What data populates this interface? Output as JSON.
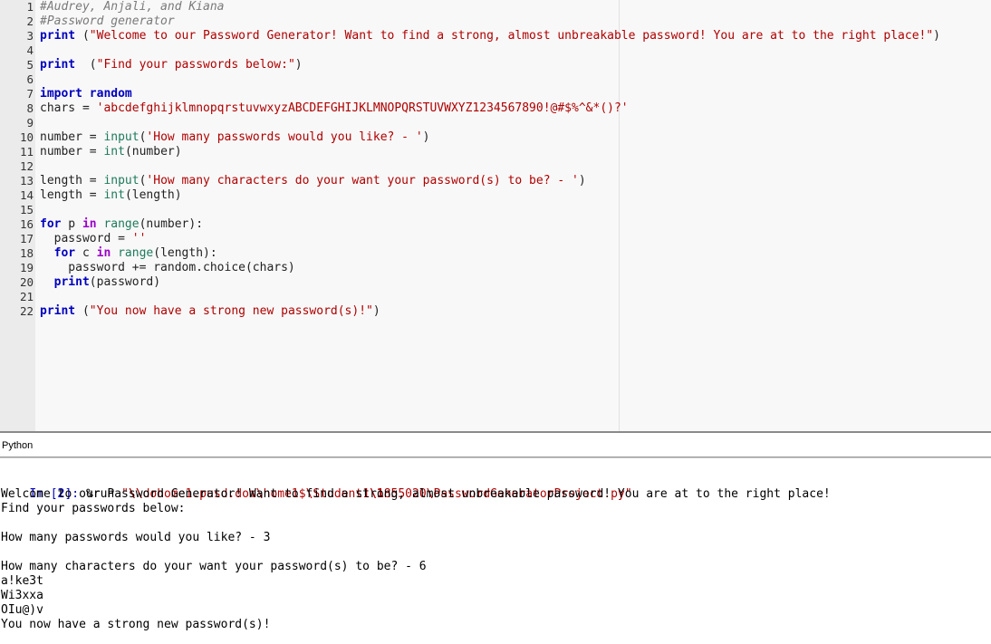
{
  "editor": {
    "lines": [
      {
        "num": "1",
        "tokens": [
          {
            "t": "#Audrey, Anjali, and Kiana",
            "c": "cm"
          }
        ]
      },
      {
        "num": "2",
        "tokens": [
          {
            "t": "#Password generator",
            "c": "cm"
          }
        ]
      },
      {
        "num": "3",
        "tokens": [
          {
            "t": "print",
            "c": "kw"
          },
          {
            "t": " (",
            "c": "pl"
          },
          {
            "t": "\"Welcome to our Password Generator! Want to find a strong, almost unbreakable password! You are at to the right place!\"",
            "c": "st"
          },
          {
            "t": ")",
            "c": "pl"
          }
        ]
      },
      {
        "num": "4",
        "tokens": []
      },
      {
        "num": "5",
        "tokens": [
          {
            "t": "print",
            "c": "kw"
          },
          {
            "t": "  (",
            "c": "pl"
          },
          {
            "t": "\"Find your passwords below:\"",
            "c": "st"
          },
          {
            "t": ")",
            "c": "pl"
          }
        ]
      },
      {
        "num": "6",
        "tokens": []
      },
      {
        "num": "7",
        "tokens": [
          {
            "t": "import",
            "c": "kw"
          },
          {
            "t": " ",
            "c": "pl"
          },
          {
            "t": "random",
            "c": "kw"
          }
        ]
      },
      {
        "num": "8",
        "tokens": [
          {
            "t": "chars = ",
            "c": "pl"
          },
          {
            "t": "'abcdefghijklmnopqrstuvwxyzABCDEFGHIJKLMNOPQRSTUVWXYZ1234567890!@#$%^&*()?'",
            "c": "st"
          }
        ]
      },
      {
        "num": "9",
        "tokens": []
      },
      {
        "num": "10",
        "tokens": [
          {
            "t": "number = ",
            "c": "pl"
          },
          {
            "t": "input",
            "c": "bi"
          },
          {
            "t": "(",
            "c": "pl"
          },
          {
            "t": "'How many passwords would you like? - '",
            "c": "st"
          },
          {
            "t": ")",
            "c": "pl"
          }
        ]
      },
      {
        "num": "11",
        "tokens": [
          {
            "t": "number = ",
            "c": "pl"
          },
          {
            "t": "int",
            "c": "bi"
          },
          {
            "t": "(number)",
            "c": "pl"
          }
        ]
      },
      {
        "num": "12",
        "tokens": []
      },
      {
        "num": "13",
        "tokens": [
          {
            "t": "length = ",
            "c": "pl"
          },
          {
            "t": "input",
            "c": "bi"
          },
          {
            "t": "(",
            "c": "pl"
          },
          {
            "t": "'How many characters do your want your password(s) to be? - '",
            "c": "st"
          },
          {
            "t": ")",
            "c": "pl"
          }
        ]
      },
      {
        "num": "14",
        "tokens": [
          {
            "t": "length = ",
            "c": "pl"
          },
          {
            "t": "int",
            "c": "bi"
          },
          {
            "t": "(length)",
            "c": "pl"
          }
        ]
      },
      {
        "num": "15",
        "tokens": []
      },
      {
        "num": "16",
        "tokens": [
          {
            "t": "for",
            "c": "kw"
          },
          {
            "t": " p ",
            "c": "pl"
          },
          {
            "t": "in",
            "c": "kwp"
          },
          {
            "t": " ",
            "c": "pl"
          },
          {
            "t": "range",
            "c": "bi"
          },
          {
            "t": "(number):",
            "c": "pl"
          }
        ]
      },
      {
        "num": "17",
        "tokens": [
          {
            "t": "  password = ",
            "c": "pl"
          },
          {
            "t": "''",
            "c": "st"
          }
        ]
      },
      {
        "num": "18",
        "tokens": [
          {
            "t": "  ",
            "c": "pl"
          },
          {
            "t": "for",
            "c": "kw"
          },
          {
            "t": " c ",
            "c": "pl"
          },
          {
            "t": "in",
            "c": "kwp"
          },
          {
            "t": " ",
            "c": "pl"
          },
          {
            "t": "range",
            "c": "bi"
          },
          {
            "t": "(length):",
            "c": "pl"
          }
        ]
      },
      {
        "num": "19",
        "tokens": [
          {
            "t": "    password += random.choice(chars)",
            "c": "pl"
          }
        ]
      },
      {
        "num": "20",
        "tokens": [
          {
            "t": "  ",
            "c": "pl"
          },
          {
            "t": "print",
            "c": "kw"
          },
          {
            "t": "(password)",
            "c": "pl"
          }
        ]
      },
      {
        "num": "21",
        "tokens": []
      },
      {
        "num": "22",
        "tokens": [
          {
            "t": "print",
            "c": "kw"
          },
          {
            "t": " (",
            "c": "pl"
          },
          {
            "t": "\"You now have a strong new password(s)!\"",
            "c": "st"
          },
          {
            "t": ")",
            "c": "pl"
          }
        ]
      }
    ]
  },
  "lang_bar": {
    "label": "Python"
  },
  "console": {
    "prompt_in": "In [",
    "prompt_num": "2",
    "prompt_end": "]: ",
    "run_cmd": "%run ",
    "run_path_parts": [
      {
        "t": "\"",
        "c": "run-str"
      },
      {
        "t": "\\\\",
        "c": "run-esc"
      },
      {
        "t": "dohome1.pusd.dom",
        "c": "run-str"
      },
      {
        "t": "\\h",
        "c": "run-str"
      },
      {
        "t": "ome1$",
        "c": "run-str"
      },
      {
        "t": "\\S",
        "c": "run-str"
      },
      {
        "t": "tudent1",
        "c": "run-str"
      },
      {
        "t": "\\1",
        "c": "run-esc"
      },
      {
        "t": "855020",
        "c": "run-str"
      },
      {
        "t": "\\P",
        "c": "run-str"
      },
      {
        "t": "asswordGeneratorProject.py\"",
        "c": "run-str"
      }
    ],
    "output": [
      "Welcome to our Password Generator! Want to find a strong, almost unbreakable password! You are at to the right place!",
      "Find your passwords below:",
      "",
      "How many passwords would you like? - 3",
      "",
      "How many characters do your want your password(s) to be? - 6",
      "a!ke3t",
      "Wi3xxa",
      "OIu@)v",
      "You now have a strong new password(s)!"
    ]
  }
}
